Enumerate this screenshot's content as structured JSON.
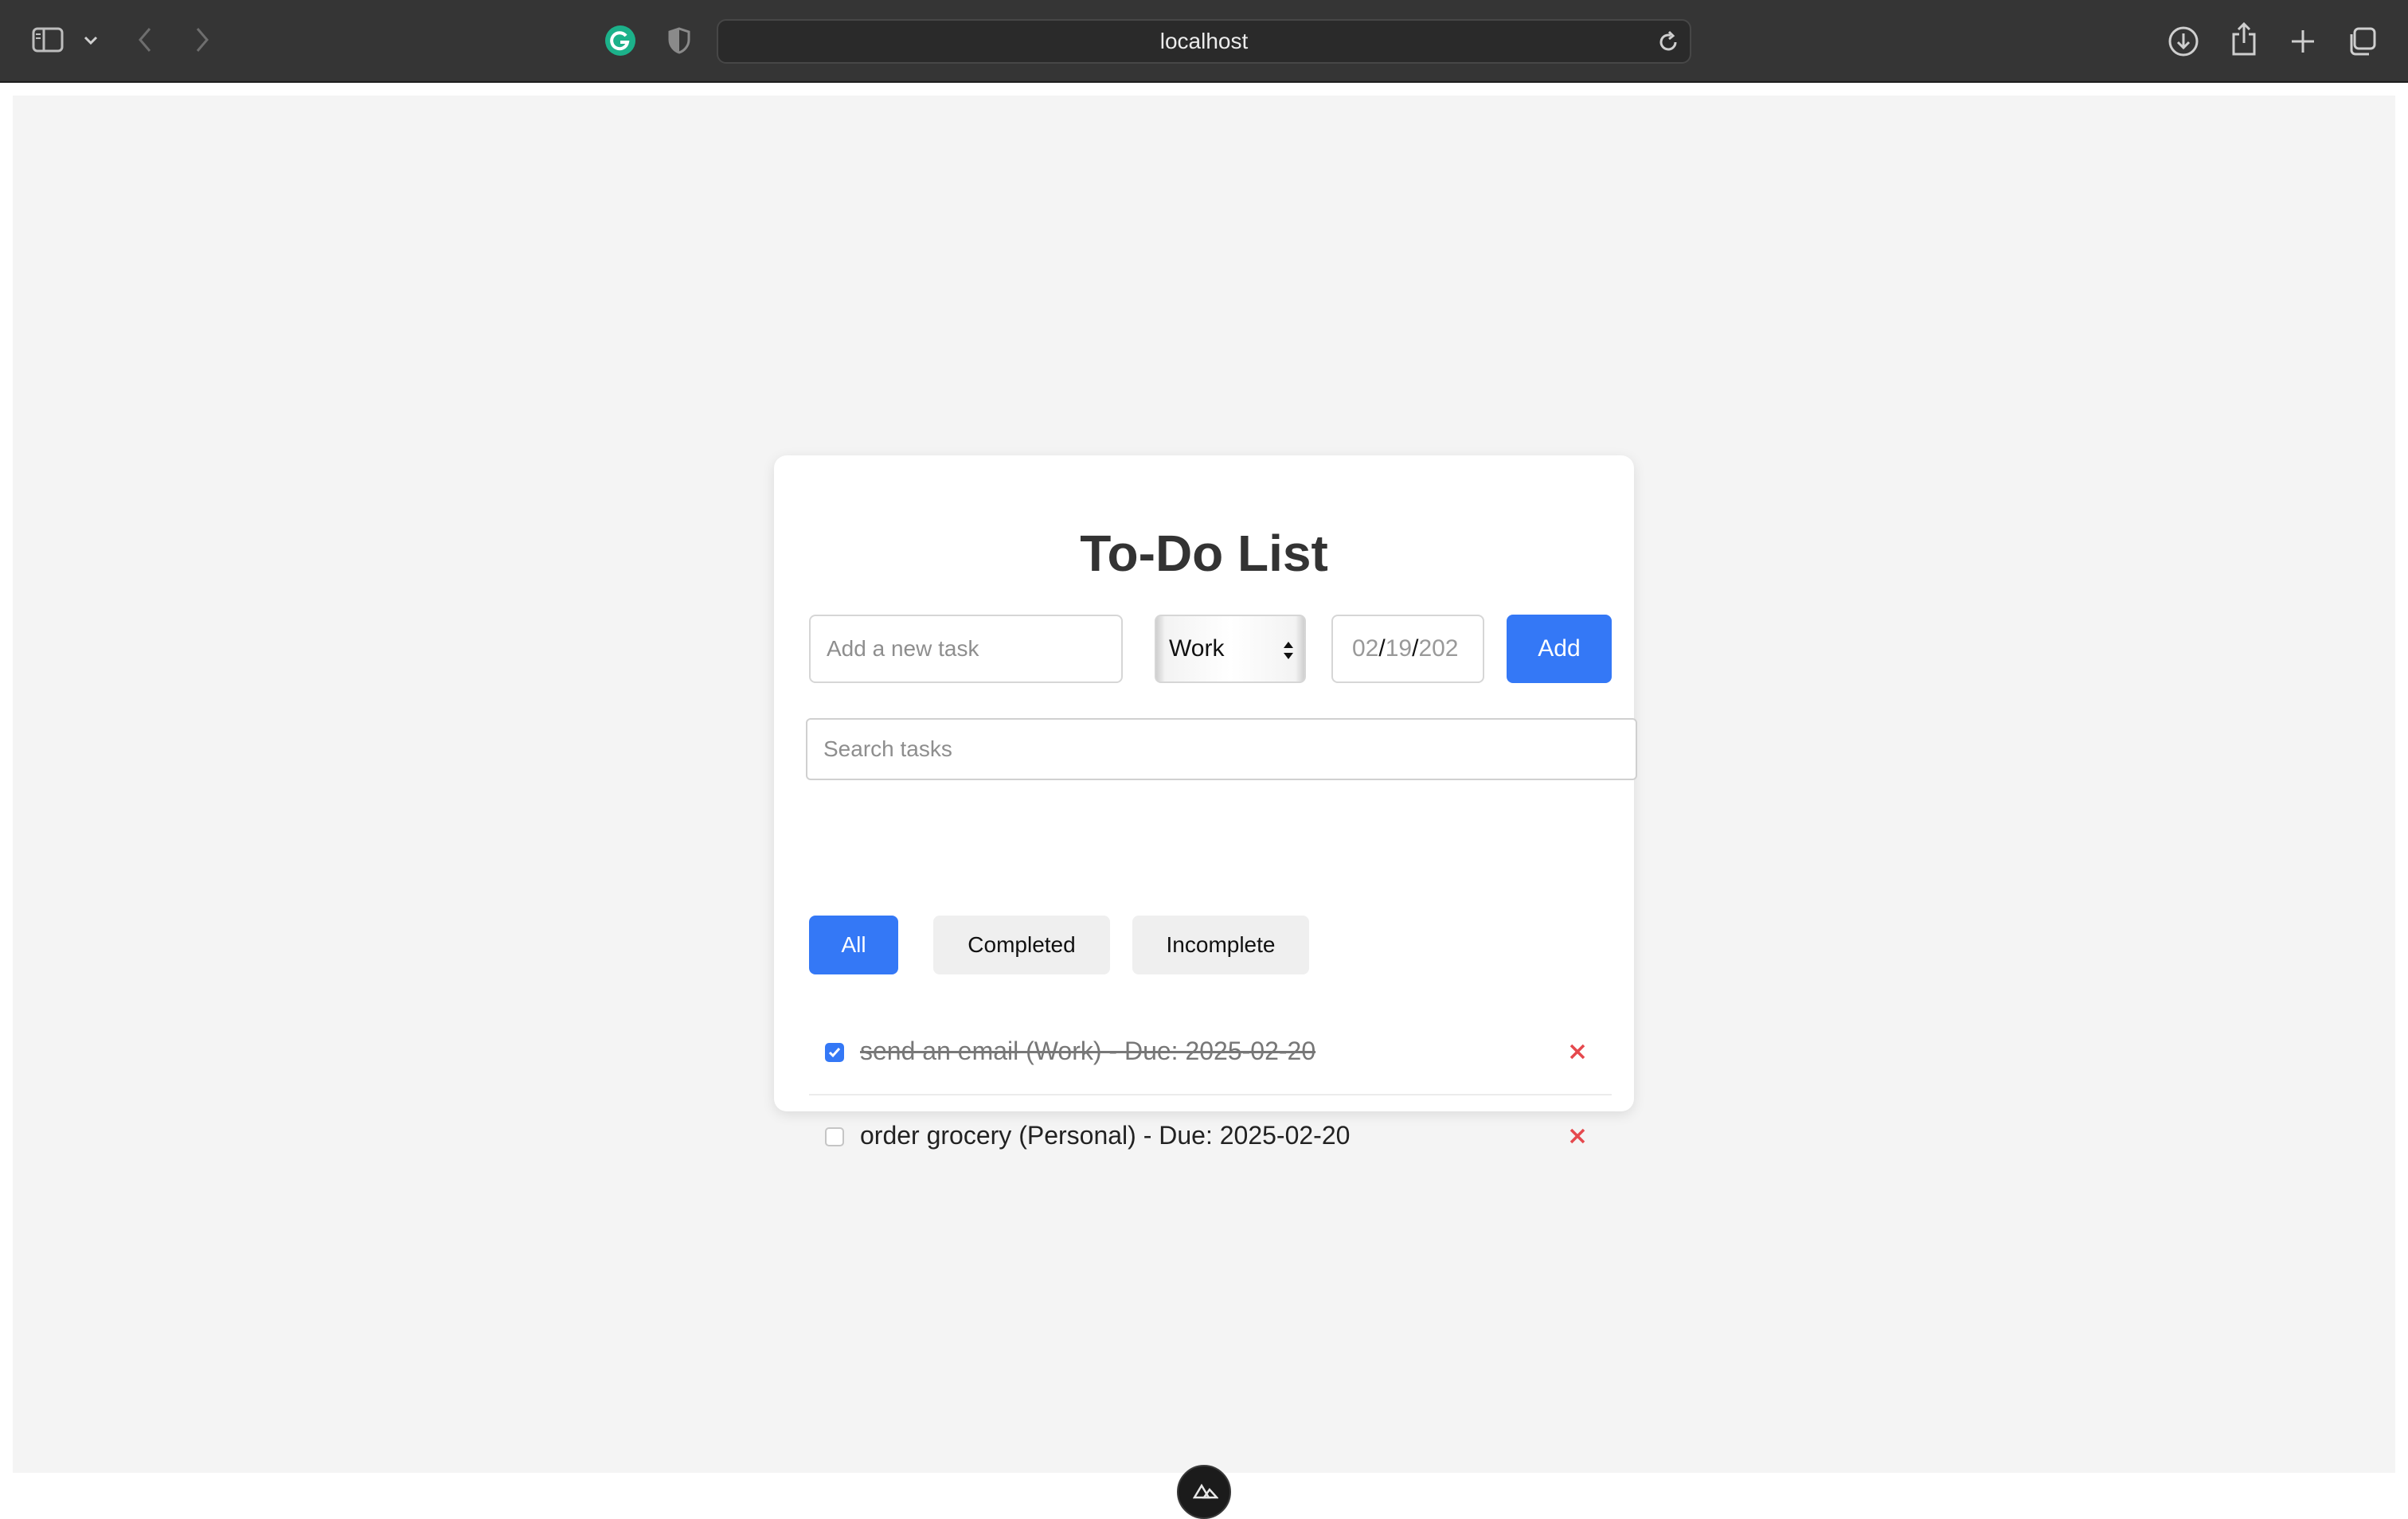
{
  "browser": {
    "url": "localhost"
  },
  "app": {
    "title": "To-Do List",
    "new_task": {
      "placeholder": "Add a new task",
      "value": ""
    },
    "category": {
      "selected": "Work"
    },
    "due_date": {
      "month": "02",
      "day": "19",
      "year": "202"
    },
    "add_label": "Add",
    "search": {
      "placeholder": "Search tasks",
      "value": ""
    },
    "filters": [
      {
        "label": "All",
        "active": true
      },
      {
        "label": "Completed",
        "active": false
      },
      {
        "label": "Incomplete",
        "active": false
      }
    ],
    "tasks": [
      {
        "text": "send an email (Work) - Due: 2025-02-20",
        "completed": true
      },
      {
        "text": "order grocery (Personal) - Due: 2025-02-20",
        "completed": false
      }
    ]
  },
  "colors": {
    "accent": "#3478f6",
    "delete": "#e5484d",
    "page_background": "#f4f4f4",
    "toolbar": "#353535"
  }
}
